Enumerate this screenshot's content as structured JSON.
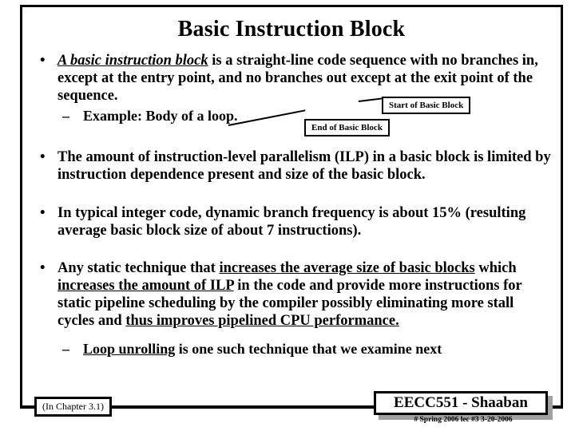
{
  "slide": {
    "title": "Basic Instruction Block",
    "bullets": [
      {
        "marker": "•",
        "lead_emphasis": "A basic instruction block",
        "text": " is a straight-line code sequence with no branches in, except at the entry point,  and no branches out except at the exit point of the sequence.",
        "sub": {
          "marker": "–",
          "text": "Example:  Body of a loop."
        }
      },
      {
        "marker": "•",
        "text": "The amount of instruction-level parallelism (ILP) in a basic block is limited by instruction dependence present and size of the basic block."
      },
      {
        "marker": "•",
        "text": "In typical integer code, dynamic branch frequency is about 15% (resulting average basic block size of about 7 instructions)."
      },
      {
        "marker": "•",
        "part1": "Any static technique that ",
        "underline1": "increases the average size of basic blocks",
        "part2": "  which ",
        "underline2": "increases the amount of ILP",
        "part3": " in the code and provide more instructions for static pipeline scheduling by the compiler possibly eliminating more stall cycles and ",
        "underline3": "thus improves pipelined CPU performance.",
        "sub": {
          "marker": "–",
          "underline": "Loop unrolling",
          "text": " is one such technique that we examine next"
        }
      }
    ],
    "callouts": [
      {
        "label": "Start of Basic Block"
      },
      {
        "label": "End of Basic Block"
      }
    ]
  },
  "footer": {
    "chapter_note": "(In  Chapter 3.1)",
    "course_badge": "EECC551 - Shaaban",
    "date_line": "#  Spring 2006  lec #3   3-20-2006"
  }
}
